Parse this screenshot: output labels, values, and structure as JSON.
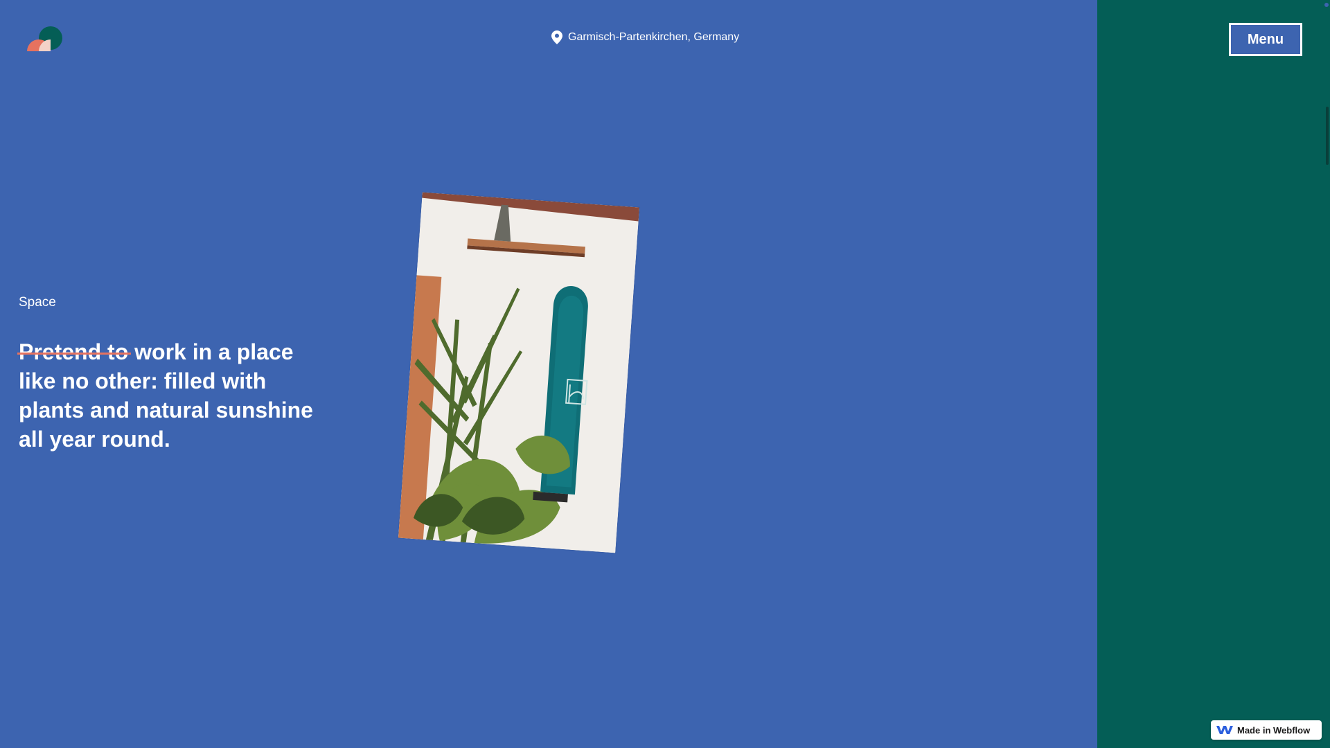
{
  "header": {
    "location": "Garmisch-Partenkirchen, Germany",
    "menu_label": "Menu"
  },
  "section": {
    "label": "Space",
    "headline_struck": "Pretend to",
    "headline_rest": " work in a place like no other: filled with plants and natural sunshine all year round."
  },
  "badge": {
    "label": "Made in Webflow"
  },
  "icons": {
    "logo": "brand-logo-icon",
    "location": "map-pin-icon",
    "badge": "webflow-icon"
  },
  "colors": {
    "main_background": "#3d64b0",
    "side_panel": "#045e56",
    "strike_accent": "#e6725f",
    "logo_teal": "#045e56",
    "logo_coral": "#e6725f",
    "logo_pink": "#f3d2c8"
  }
}
